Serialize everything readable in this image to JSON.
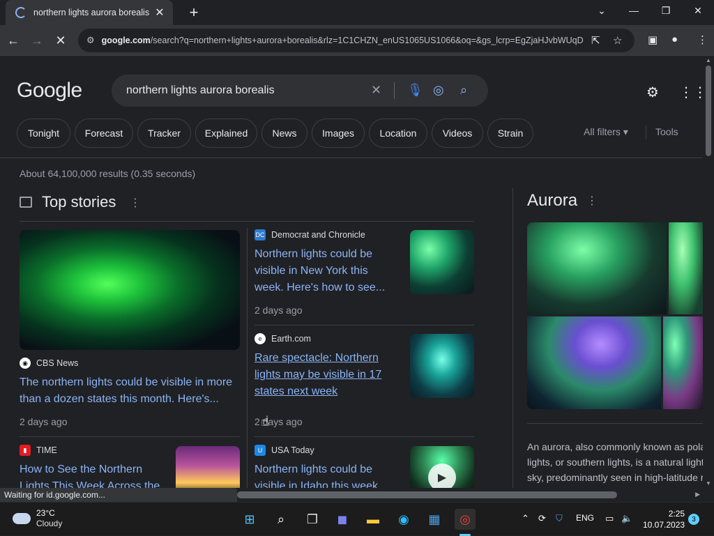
{
  "browser": {
    "tab_title": "northern lights aurora borealis",
    "url_bold": "google.com",
    "url_rest": "/search?q=northern+lights+aurora+borealis&rlz=1C1CHZN_enUS1065US1066&oq=&gs_lcrp=EgZjaHJvbWUqDggE...",
    "status_text": "Waiting for id.google.com..."
  },
  "search": {
    "logo": "Google",
    "query": "northern lights aurora borealis",
    "chips": [
      "Tonight",
      "Forecast",
      "Tracker",
      "Explained",
      "News",
      "Images",
      "Location",
      "Videos",
      "Strain"
    ],
    "all_filters": "All filters",
    "tools": "Tools",
    "results_count": "About 64,100,000 results (0.35 seconds)"
  },
  "top_stories": {
    "title": "Top stories",
    "stories": [
      {
        "source": "CBS News",
        "headline": "The northern lights could be visible in more than a dozen states this month. Here's...",
        "age": "2 days ago"
      },
      {
        "source": "Democrat and Chronicle",
        "headline": "Northern lights could be visible in New York this week. Here's how to see...",
        "age": "2 days ago"
      },
      {
        "source": "Earth.com",
        "headline": "Rare spectacle: Northern lights may be visible in 17 states next week",
        "age": "2 days ago"
      },
      {
        "source": "TIME",
        "headline": "How to See the Northern Lights This Week Across the",
        "age": ""
      },
      {
        "source": "USA Today",
        "headline": "Northern lights could be visible in Idaho this week.",
        "age": ""
      }
    ]
  },
  "knowledge_panel": {
    "title": "Aurora",
    "description_lines": [
      "An aurora, also commonly known as pola",
      "lights, or southern lights, is a natural light",
      "sky, predominantly seen in high-latitude r"
    ]
  },
  "taskbar": {
    "temperature": "23°C",
    "weather": "Cloudy",
    "language": "ENG",
    "time": "2:25",
    "date": "10.07.2023",
    "notifications": "3"
  }
}
